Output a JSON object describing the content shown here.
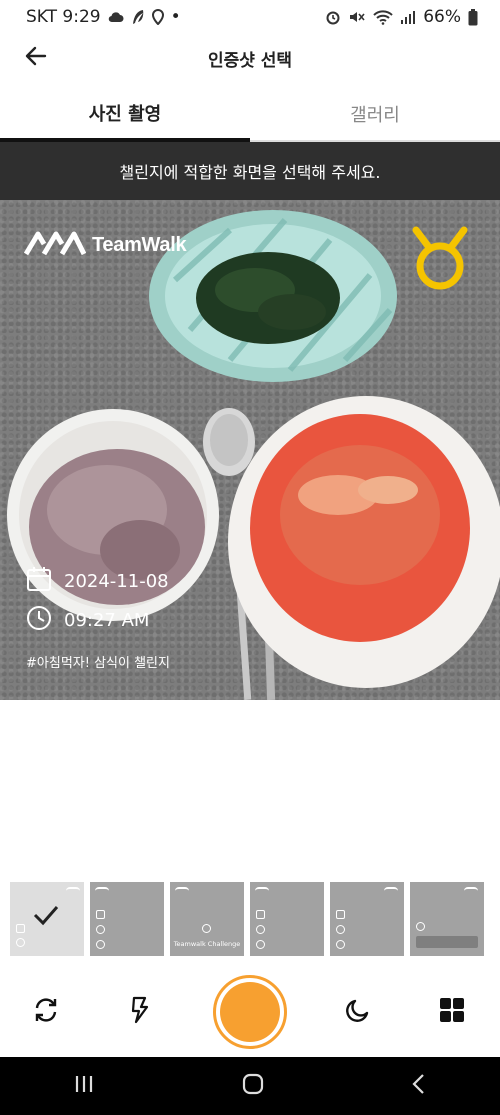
{
  "status_bar": {
    "carrier_time": "SKT 9:29",
    "dot": "•",
    "battery": "66%",
    "icons": [
      "cloud-icon",
      "feather-icon",
      "location-pin-icon",
      "alarm-icon",
      "mute-icon",
      "wifi-icon",
      "signal-icon",
      "battery-icon"
    ]
  },
  "header": {
    "title": "인증샷 선택",
    "back_icon": "arrow-left-icon"
  },
  "tabs": [
    {
      "label": "사진 촬영",
      "active": true
    },
    {
      "label": "갤러리",
      "active": false
    }
  ],
  "banner": {
    "text": "챌린지에 적합한 화면을 선택해 주세요."
  },
  "photo_overlay": {
    "brand": "TeamWalk",
    "date": "2024-11-08",
    "time": "09:27 AM",
    "hashtag": "#아침먹자! 삼식이 챌린지",
    "medal_color": "#f5c400"
  },
  "thumbnails": {
    "selected_index": 0,
    "challenge_label": "Teamwalk Challenge",
    "count": 6
  },
  "controls": {
    "icons": [
      "rotate-camera-icon",
      "flash-icon",
      "shutter-button",
      "night-mode-icon",
      "grid-icon"
    ],
    "accent": "#f7a030"
  },
  "navbar": {
    "icons": [
      "recent-apps-icon",
      "home-icon",
      "back-icon"
    ]
  }
}
